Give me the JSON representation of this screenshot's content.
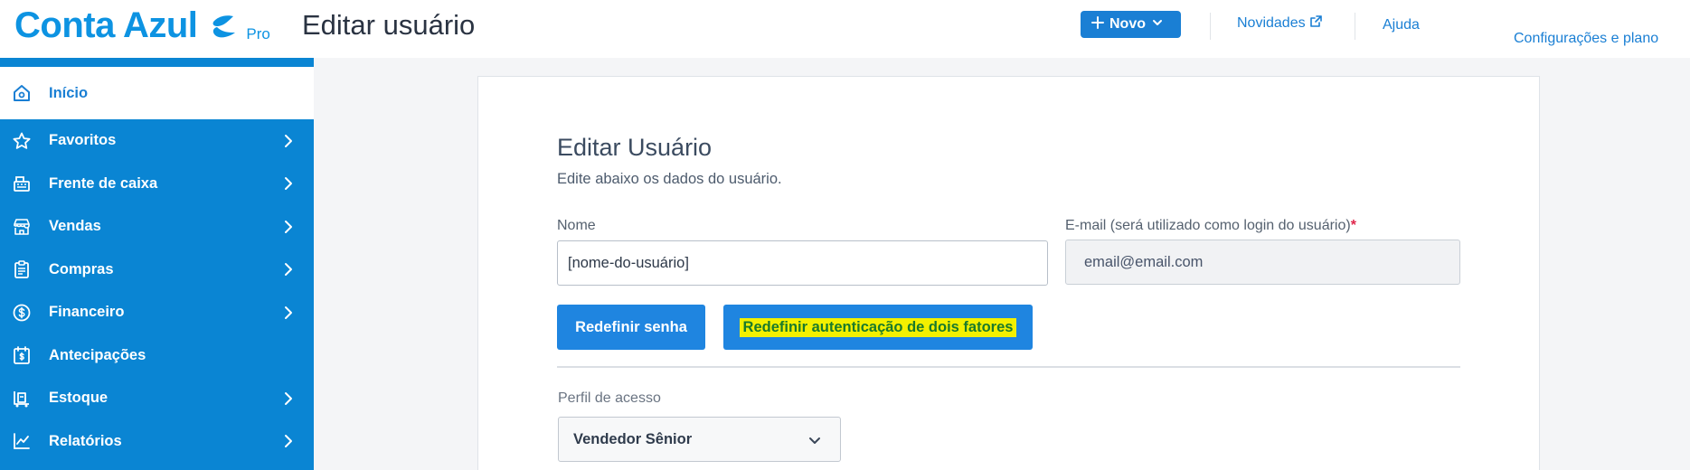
{
  "header": {
    "logo_text": "Conta Azul",
    "logo_badge": "Pro",
    "page_title": "Editar usuário",
    "new_button_label": "Novo",
    "links": {
      "novidades": "Novidades",
      "ajuda": "Ajuda",
      "config": "Configurações e plano"
    }
  },
  "sidebar": {
    "items": [
      {
        "label": "Início",
        "icon": "home-icon",
        "active": true
      },
      {
        "label": "Favoritos",
        "icon": "star-icon",
        "has_submenu": true
      },
      {
        "label": "Frente de caixa",
        "icon": "cash-register-icon",
        "has_submenu": true
      },
      {
        "label": "Vendas",
        "icon": "store-icon",
        "has_submenu": true
      },
      {
        "label": "Compras",
        "icon": "clipboard-icon",
        "has_submenu": true
      },
      {
        "label": "Financeiro",
        "icon": "dollar-circle-icon",
        "has_submenu": true
      },
      {
        "label": "Antecipações",
        "icon": "calendar-dollar-icon",
        "has_submenu": false
      },
      {
        "label": "Estoque",
        "icon": "box-icon",
        "has_submenu": true
      },
      {
        "label": "Relatórios",
        "icon": "chart-line-icon",
        "has_submenu": true
      }
    ]
  },
  "form": {
    "title": "Editar Usuário",
    "subtitle": "Edite abaixo os dados do usuário.",
    "name_label": "Nome",
    "name_value": "[nome-do-usuário]",
    "email_label": "E-mail (será utilizado como login do usuário)",
    "email_required_mark": "*",
    "email_value": "email@email.com",
    "reset_password_label": "Redefinir senha",
    "reset_2fa_label": "Redefinir autenticação de dois fatores",
    "profile_label": "Perfil de acesso",
    "profile_value": "Vendedor Sênior"
  },
  "colors": {
    "brand": "#0d93e2",
    "sidebar": "#0a85d3",
    "primary_button": "#1f85e0",
    "highlight": "#f3f000",
    "required": "#e0264b"
  }
}
